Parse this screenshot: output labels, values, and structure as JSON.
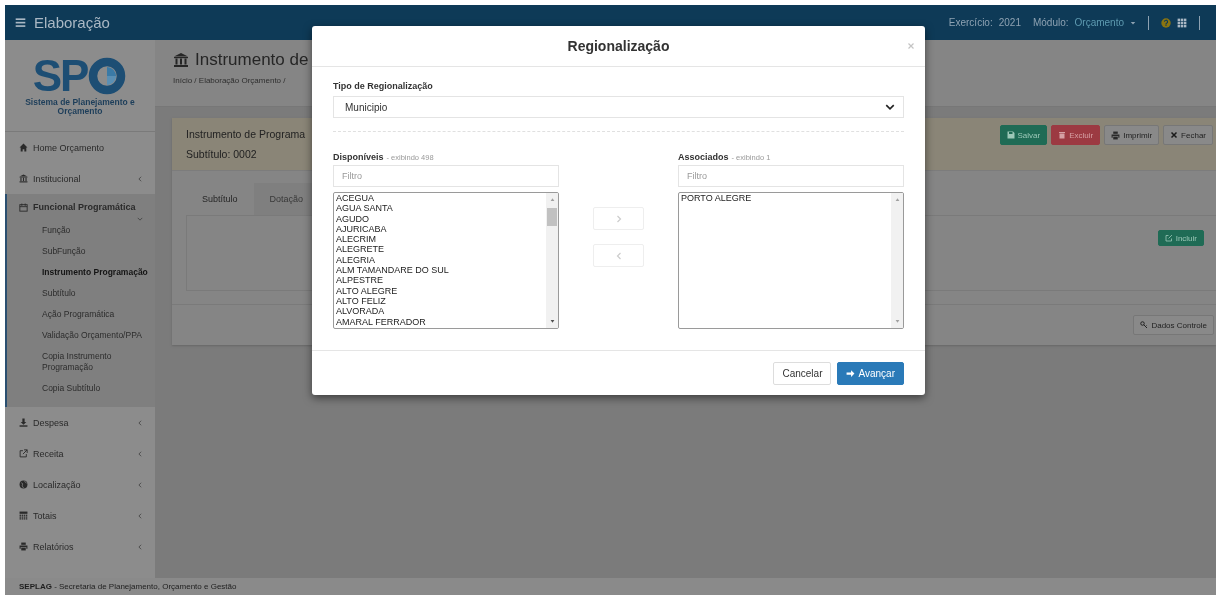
{
  "top_bar": {
    "title": "Elaboração",
    "exercicio_label": "Exercício:",
    "exercicio": "2021",
    "modulo_label": "Módulo:",
    "modulo": "Orçamento"
  },
  "sidebar": {
    "logo_text": "SP",
    "logo_subtitle": "Sistema de Planejamento e Orçamento",
    "items": [
      {
        "label": "Home Orçamento",
        "kind": "link"
      },
      {
        "label": "Institucional",
        "kind": "menu",
        "expanded": false
      },
      {
        "label": "Funcional Programática",
        "kind": "menu",
        "expanded": true,
        "children": [
          {
            "label": "Função",
            "selected": false
          },
          {
            "label": "SubFunção",
            "selected": false
          },
          {
            "label": "Instrumento Programação",
            "selected": true
          },
          {
            "label": "Subtítulo",
            "selected": false
          },
          {
            "label": "Ação Programática",
            "selected": false
          },
          {
            "label": "Validação Orçamento/PPA",
            "selected": false
          },
          {
            "label": "Copia Instrumento Programação",
            "selected": false
          },
          {
            "label": "Copia Subtítulo",
            "selected": false
          }
        ]
      },
      {
        "label": "Despesa",
        "kind": "menu",
        "expanded": false
      },
      {
        "label": "Receita",
        "kind": "menu",
        "expanded": false
      },
      {
        "label": "Localização",
        "kind": "menu",
        "expanded": false
      },
      {
        "label": "Totais",
        "kind": "menu",
        "expanded": false
      },
      {
        "label": "Relatórios",
        "kind": "menu",
        "expanded": false
      }
    ]
  },
  "page": {
    "title": "Instrumento de",
    "breadcrumb": "Início / Elaboração Orçamento /"
  },
  "card": {
    "heading": "Instrumento de Programa",
    "subtitle": "Subtítulo: 0002",
    "actions": [
      {
        "label": "Salvar",
        "kind": "success"
      },
      {
        "label": "Excluir",
        "kind": "danger"
      },
      {
        "label": "Imprimir",
        "kind": "print"
      },
      {
        "label": "Fechar",
        "kind": "close"
      }
    ],
    "tabs": [
      {
        "label": "Subtítulo",
        "selected": true
      },
      {
        "label": "Dotação",
        "selected": false
      }
    ],
    "include_button": "Incluir",
    "footer_button": "Dados Controle"
  },
  "modal": {
    "title": "Regionalização",
    "type_label": "Tipo de Regionalização",
    "type_value": "Municipio",
    "available": {
      "title": "Disponíveis",
      "count": "- exibindo 498",
      "filter_placeholder": "Filtro",
      "items": [
        "ACEGUA",
        "AGUA SANTA",
        "AGUDO",
        "AJURICABA",
        "ALECRIM",
        "ALEGRETE",
        "ALEGRIA",
        "ALM TAMANDARE DO SUL",
        "ALPESTRE",
        "ALTO ALEGRE",
        "ALTO FELIZ",
        "ALVORADA",
        "AMARAL FERRADOR"
      ]
    },
    "associated": {
      "title": "Associados",
      "count": "- exibindo 1",
      "filter_placeholder": "Filtro",
      "items": [
        "PORTO ALEGRE"
      ]
    },
    "cancel": "Cancelar",
    "confirm": "Avançar"
  },
  "footer": "**SEPLAG** - Secretaria de Planejamento, Orçamento e Gestão"
}
